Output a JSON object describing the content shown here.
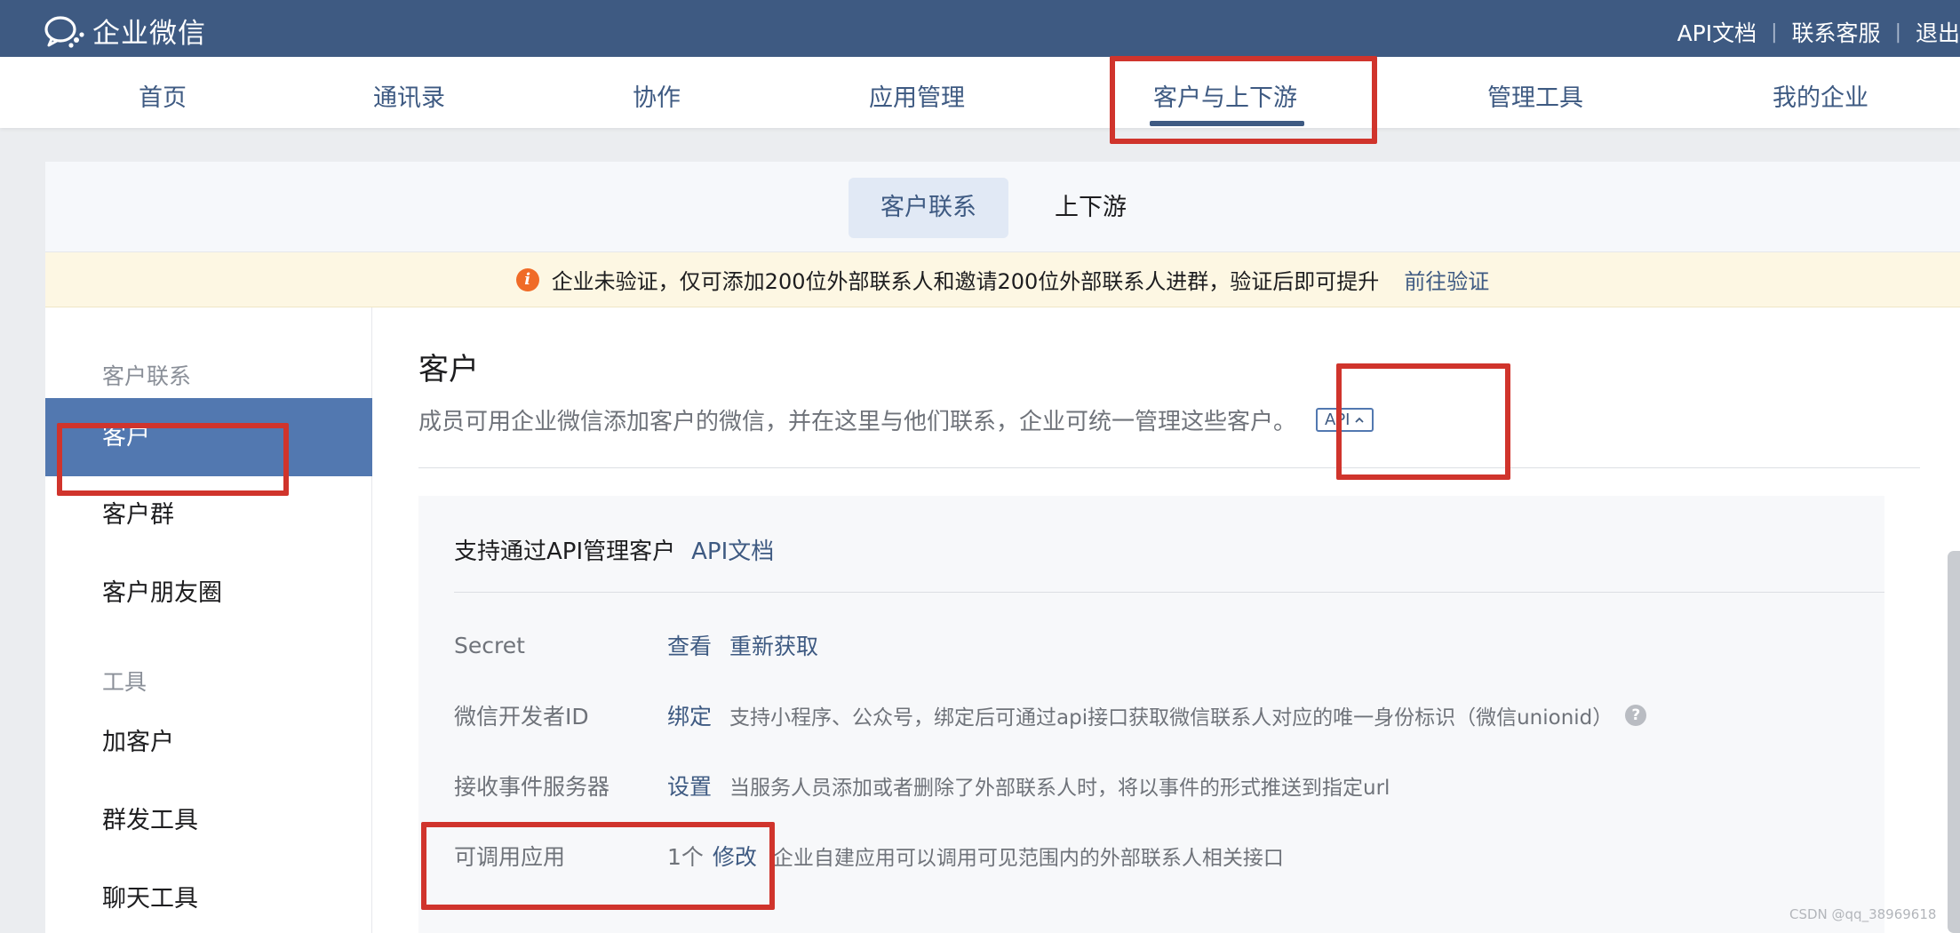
{
  "app": {
    "name": "企业微信",
    "top_links": [
      "API文档",
      "联系客服",
      "退出"
    ]
  },
  "nav": {
    "items": [
      "首页",
      "通讯录",
      "协作",
      "应用管理",
      "客户与上下游",
      "管理工具",
      "我的企业"
    ],
    "active": "客户与上下游"
  },
  "subnav": {
    "tabs": [
      "客户联系",
      "上下游"
    ],
    "active": "客户联系"
  },
  "notice": {
    "text": "企业未验证，仅可添加200位外部联系人和邀请200位外部联系人进群，验证后即可提升",
    "link": "前往验证"
  },
  "sidebar": {
    "group1": "客户联系",
    "items1": [
      "客户",
      "客户群",
      "客户朋友圈"
    ],
    "group2": "工具",
    "items2": [
      "加客户",
      "群发工具",
      "聊天工具"
    ],
    "active": "客户"
  },
  "main": {
    "title": "客户",
    "description": "成员可用企业微信添加客户的微信，并在这里与他们联系，企业可统一管理这些客户。",
    "api_badge": "API",
    "api_section": {
      "heading": "支持通过API管理客户",
      "doc_link": "API文档",
      "rows": [
        {
          "label": "Secret",
          "links": [
            "查看",
            "重新获取"
          ],
          "desc": ""
        },
        {
          "label": "微信开发者ID",
          "links": [
            "绑定"
          ],
          "desc": "支持小程序、公众号，绑定后可通过api接口获取微信联系人对应的唯一身份标识（微信unionid）"
        },
        {
          "label": "接收事件服务器",
          "links": [
            "设置"
          ],
          "desc": "当服务人员添加或者删除了外部联系人时，将以事件的形式推送到指定url"
        },
        {
          "label": "可调用应用",
          "count": "1个",
          "links": [
            "修改"
          ],
          "desc": "企业自建应用可以调用可见范围内的外部联系人相关接口"
        }
      ]
    }
  },
  "watermark": "CSDN @qq_38969618",
  "colors": {
    "brand": "#3e5a82",
    "sidebar_active": "#5278b0",
    "annotation": "#d0342c",
    "notice_bg": "#fdf7e3"
  }
}
